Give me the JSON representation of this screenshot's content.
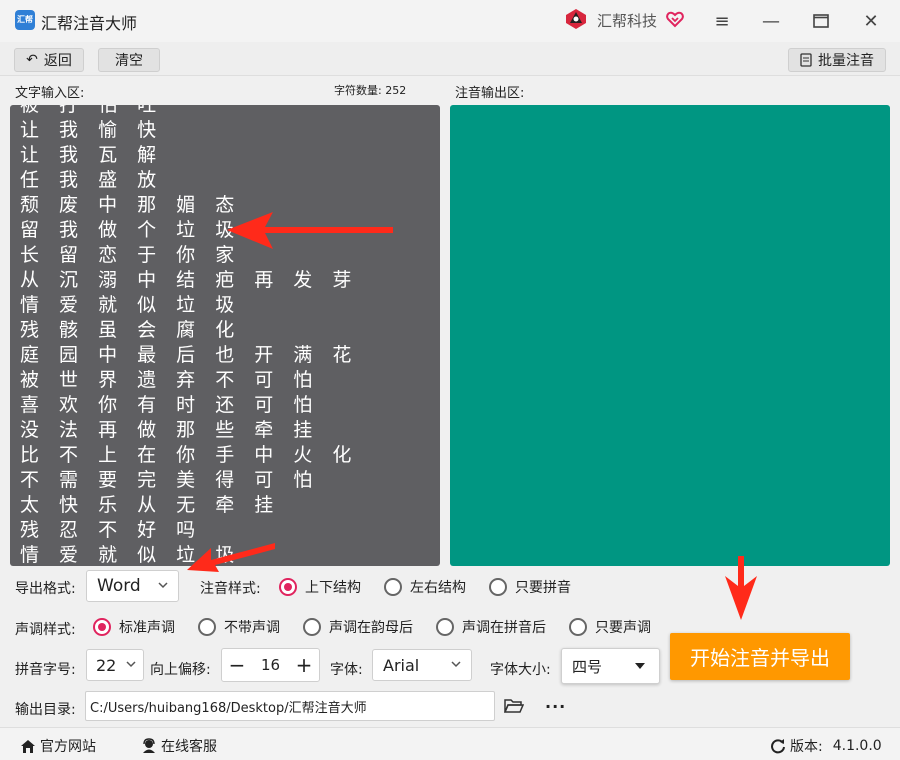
{
  "titlebar": {
    "logo_text": "汇帮",
    "app_title": "汇帮注音大师",
    "brand_name": "汇帮科技"
  },
  "toolbar": {
    "back_label": "返回",
    "clear_label": "清空",
    "batch_label": "批量注音"
  },
  "input": {
    "label": "文字输入区:",
    "char_count_label": "字符数量: 252",
    "lines": [
      "被 打 怕 吐",
      "让 我 愉 快",
      "让 我 瓦 解",
      "任 我 盛 放",
      "颓 废 中 那 媚 态",
      "留 我 做 个 垃 圾",
      "长 留 恋 于 你 家",
      "从 沉 溺 中 结 疤 再 发 芽",
      "情 爱 就 似 垃 圾",
      "残 骸 虽 会 腐 化",
      "庭 园 中 最 后 也 开 满 花",
      "被 世 界 遗 弃 不 可 怕",
      "喜 欢 你 有 时 还 可 怕",
      "没 法 再 做 那 些 牵 挂",
      "比 不 上 在 你 手 中 火 化",
      "不 需 要 完 美 得 可 怕",
      "太 快 乐 从 无 牵 挂",
      "残 忍 不 好 吗",
      "情 爱 就 似 垃 圾"
    ]
  },
  "output": {
    "label": "注音输出区:"
  },
  "options": {
    "export_format_label": "导出格式:",
    "export_format_value": "Word",
    "pinyin_style_label": "注音样式:",
    "pinyin_styles": [
      "上下结构",
      "左右结构",
      "只要拼音"
    ],
    "tone_style_label": "声调样式:",
    "tone_styles": [
      "标准声调",
      "不带声调",
      "声调在韵母后",
      "声调在拼音后",
      "只要声调"
    ],
    "pinyin_size_label": "拼音字号:",
    "pinyin_size_value": "22",
    "offset_label": "向上偏移:",
    "offset_value": "16",
    "font_label": "字体:",
    "font_value": "Arial",
    "font_size_label": "字体大小:",
    "font_size_value": "四号",
    "output_dir_label": "输出目录:",
    "output_dir_value": "C:/Users/huibang168/Desktop/汇帮注音大师",
    "start_label": "开始注音并导出"
  },
  "statusbar": {
    "website_label": "官方网站",
    "service_label": "在线客服",
    "version_label": "版本:",
    "version_value": "4.1.0.0"
  },
  "colors": {
    "input_bg": "#5f5f62",
    "output_bg": "#009682",
    "accent": "#ff9800",
    "radio_on": "#e0245e",
    "arrow": "#ff2a1a"
  }
}
